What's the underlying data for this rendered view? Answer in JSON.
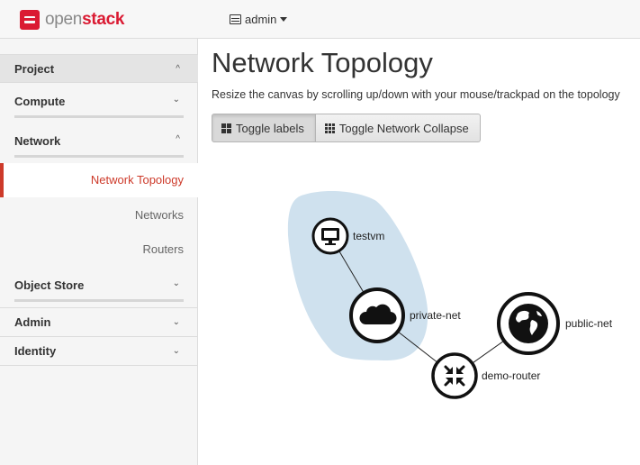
{
  "header": {
    "logo_text_light": "open",
    "logo_text_bold": "stack",
    "project_switch": "admin",
    "project_icon": "server-icon"
  },
  "sidebar": {
    "project": "Project",
    "compute": "Compute",
    "network": "Network",
    "network_items": [
      "Network Topology",
      "Networks",
      "Routers"
    ],
    "object_store": "Object Store",
    "admin": "Admin",
    "identity": "Identity",
    "chevron_up": "^",
    "chevron_down": "⌄"
  },
  "main": {
    "title": "Network Topology",
    "description": "Resize the canvas by scrolling up/down with your mouse/trackpad on the topology",
    "toggle_labels": "Toggle labels",
    "toggle_collapse": "Toggle Network Collapse"
  },
  "topology": {
    "nodes": {
      "testvm": "testvm",
      "private_net": "private-net",
      "public_net": "public-net",
      "demo_router": "demo-router"
    },
    "colors": {
      "network_zone": "#cfe1ee",
      "accent": "#cd3a2a"
    }
  }
}
